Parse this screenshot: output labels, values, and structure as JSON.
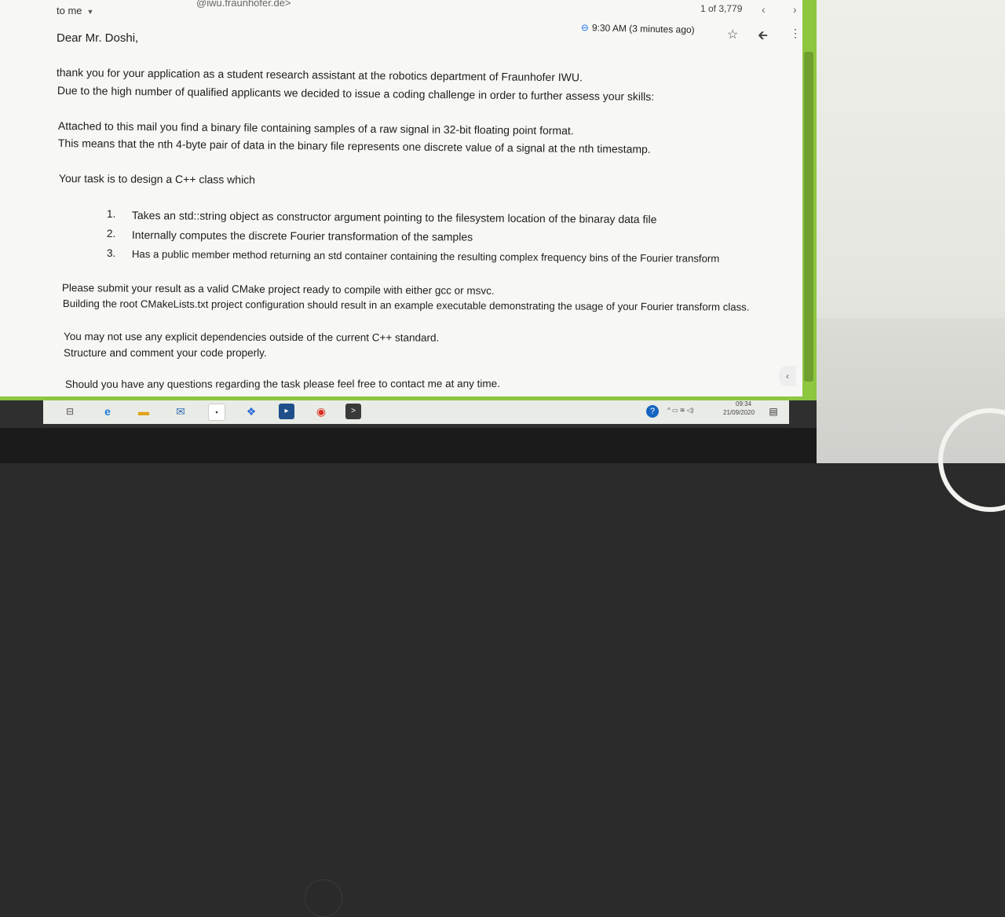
{
  "header": {
    "sender_fragment": "@iwu.fraunhofer.de>",
    "recipient": "to me",
    "message_count": "1 of 3,779",
    "prev_icon": "‹",
    "next_icon": "›",
    "timestamp": "9:30 AM (3 minutes ago)",
    "star_icon": "☆",
    "reply_icon": "🡰",
    "more_icon": "⋮"
  },
  "body": {
    "greeting": "Dear Mr. Doshi,",
    "p1_line1": "thank you for your application as a student research assistant at the robotics department of Fraunhofer IWU.",
    "p1_line2": "Due to the high number of qualified applicants we decided to issue a coding challenge in order to further assess your skills:",
    "p2_line1": "Attached to this mail you find a binary file containing samples of a raw signal in 32-bit floating point format.",
    "p2_line2": "This means that the nth 4-byte pair of data in the binary file represents one discrete value of a signal at the nth timestamp.",
    "task_intro": "Your task is to design a C++ class which",
    "list": [
      {
        "num": "1.",
        "text": "Takes an std::string object as constructor argument pointing to the filesystem location of the binaray data file"
      },
      {
        "num": "2.",
        "text": "Internally computes the discrete Fourier transformation of the samples"
      },
      {
        "num": "3.",
        "text": "Has a public member method returning an std container containing the resulting complex frequency bins of the Fourier transform"
      }
    ],
    "p3_line1": "Please submit your result as a valid CMake project ready to compile with either gcc or msvc.",
    "p3_line2": "Building the root CMakeLists.txt project configuration should result in an example executable demonstrating the usage of your Fourier transform class.",
    "p4_line1": "You may not use any explicit dependencies outside of the current C++ standard.",
    "p4_line2": "Structure and comment your code properly.",
    "p5_line1": "Should you have any questions regarding the task please feel free to contact me at any time."
  },
  "taskbar": {
    "time": "09:34",
    "date": "21/09/2020"
  }
}
